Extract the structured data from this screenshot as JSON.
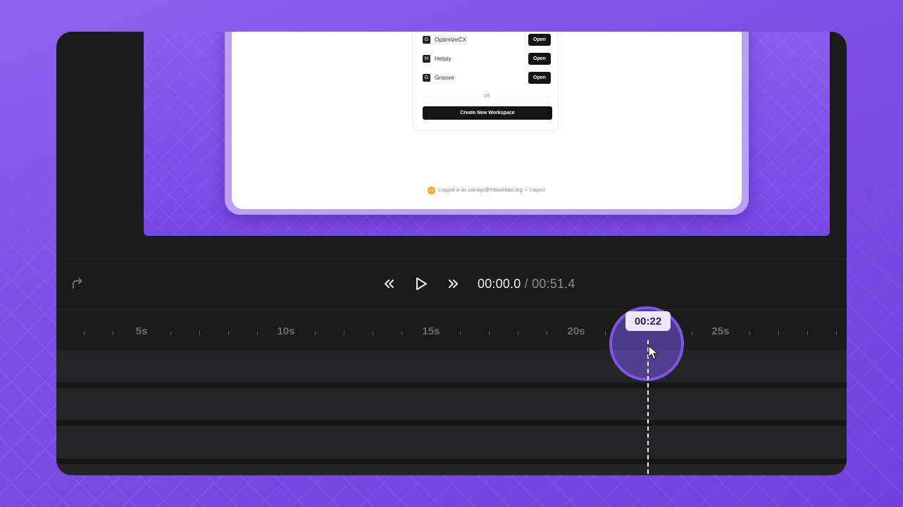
{
  "workspaces": [
    {
      "name": "OptimizeCX",
      "logo": "G",
      "button": "Open"
    },
    {
      "name": "Helpiy",
      "logo": "H",
      "button": "Open"
    },
    {
      "name": "Groove",
      "logo": "G",
      "button": "Open"
    }
  ],
  "divider_text": "OR",
  "create_button": "Create New Workspace",
  "footer": {
    "avatar_initials": "ZS",
    "logged_in_text": "Logged in as zak.tigo@frtbooklabs.org",
    "bullet": "•",
    "logout": "Logout"
  },
  "player": {
    "current_time": "00:00.0",
    "separator": "/",
    "total_time": "00:51.4",
    "playhead_time": "00:22"
  },
  "ruler": {
    "labels": [
      "5s",
      "10s",
      "15s",
      "20s",
      "25s"
    ]
  },
  "icons": {
    "redo": "redo-icon",
    "rewind": "rewind-icon",
    "play": "play-icon",
    "forward": "fast-forward-icon",
    "cursor": "mouse-cursor-icon"
  },
  "colors": {
    "background": "#7d4fe6",
    "editor": "#1b1b1c",
    "track": "#252527",
    "accent": "#7e57e8",
    "pill": "#ece6ff"
  }
}
